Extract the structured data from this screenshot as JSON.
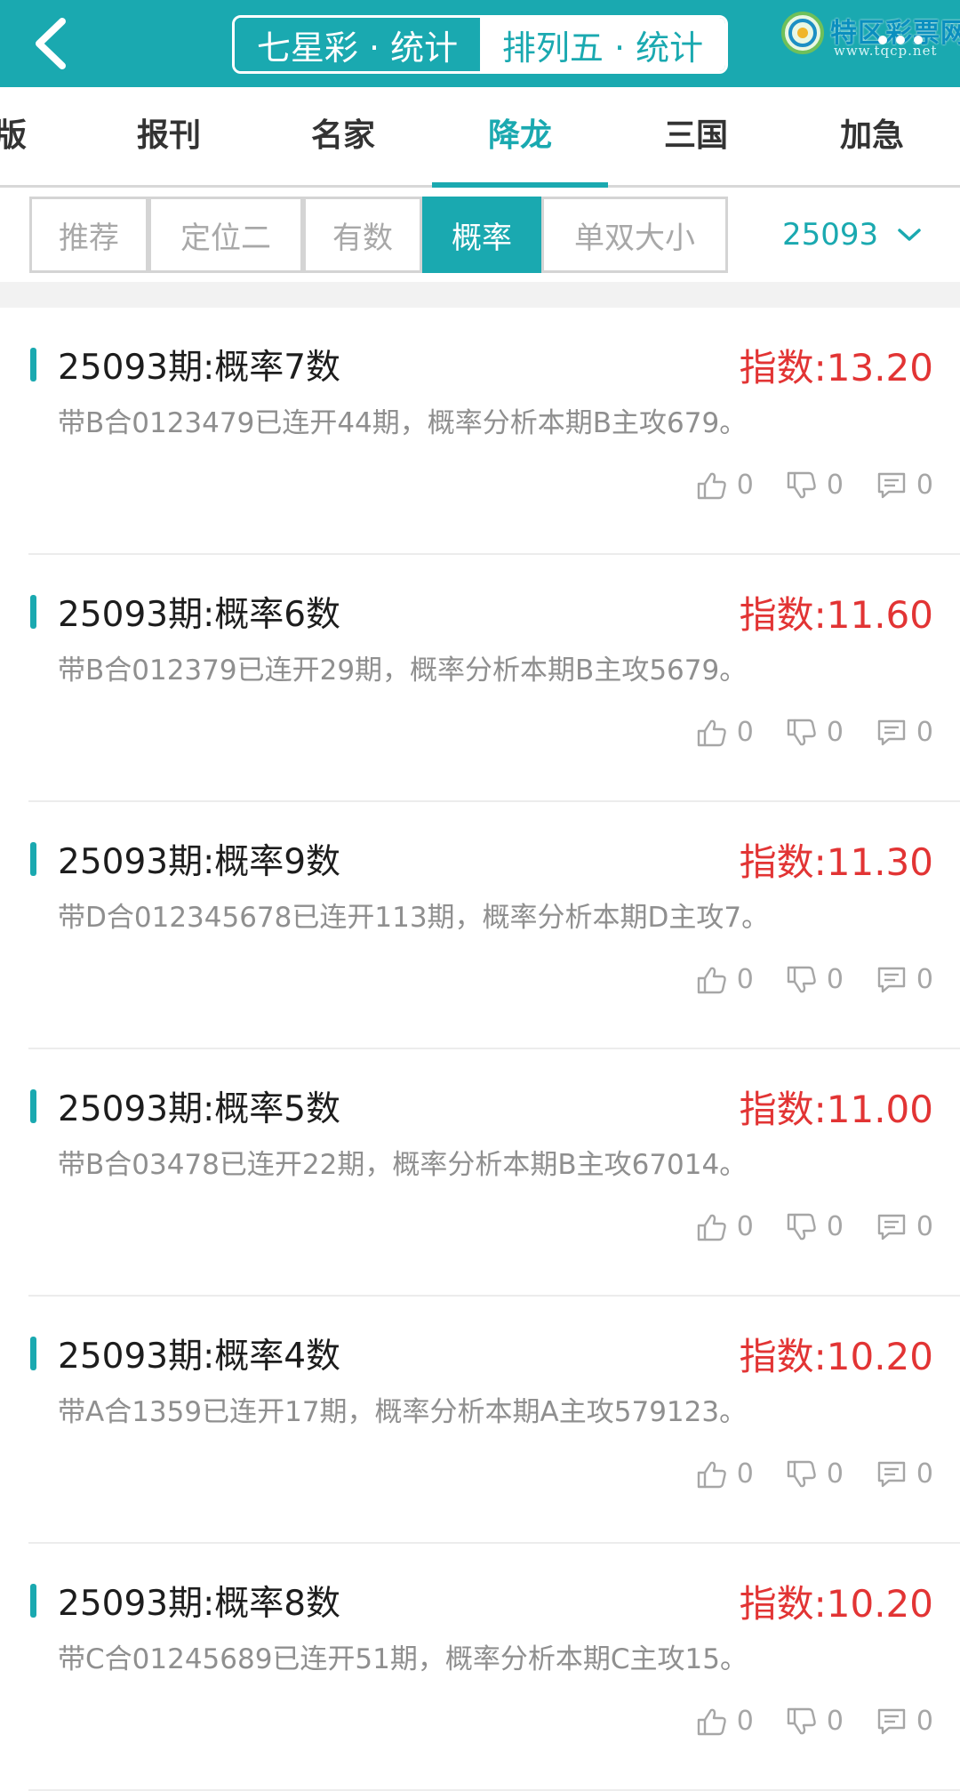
{
  "header": {
    "tabs": [
      "七星彩 · 统计",
      "排列五 · 统计"
    ],
    "logo_title": "特区彩票网",
    "logo_url": "www.tqcp.net"
  },
  "nav": {
    "items": [
      "版",
      "报刊",
      "名家",
      "降龙",
      "三国",
      "加急"
    ],
    "active": "降龙"
  },
  "filters": {
    "tabs": [
      "推荐",
      "定位二",
      "有数",
      "概率",
      "单双大小"
    ],
    "active": "概率",
    "issue": "25093"
  },
  "cards": [
    {
      "title": "25093期:概率7数",
      "index": "指数:13.20",
      "desc": "带B合0123479已连开44期，概率分析本期B主攻679。",
      "likes": "0",
      "dislikes": "0",
      "comments": "0"
    },
    {
      "title": "25093期:概率6数",
      "index": "指数:11.60",
      "desc": "带B合012379已连开29期，概率分析本期B主攻5679。",
      "likes": "0",
      "dislikes": "0",
      "comments": "0"
    },
    {
      "title": "25093期:概率9数",
      "index": "指数:11.30",
      "desc": "带D合012345678已连开113期，概率分析本期D主攻7。",
      "likes": "0",
      "dislikes": "0",
      "comments": "0"
    },
    {
      "title": "25093期:概率5数",
      "index": "指数:11.00",
      "desc": "带B合03478已连开22期，概率分析本期B主攻67014。",
      "likes": "0",
      "dislikes": "0",
      "comments": "0"
    },
    {
      "title": "25093期:概率4数",
      "index": "指数:10.20",
      "desc": "带A合1359已连开17期，概率分析本期A主攻579123。",
      "likes": "0",
      "dislikes": "0",
      "comments": "0"
    },
    {
      "title": "25093期:概率8数",
      "index": "指数:10.20",
      "desc": "带C合01245689已连开51期，概率分析本期C主攻15。",
      "likes": "0",
      "dislikes": "0",
      "comments": "0"
    }
  ],
  "colors": {
    "accent": "#1aa9b0",
    "index_red": "#e23434",
    "muted_text": "#8f8f8f"
  },
  "icons": {
    "back": "chevron-left-icon",
    "dropdown": "chevron-down-icon",
    "like": "thumbs-up-icon",
    "dislike": "thumbs-down-icon",
    "comment": "comment-icon"
  }
}
